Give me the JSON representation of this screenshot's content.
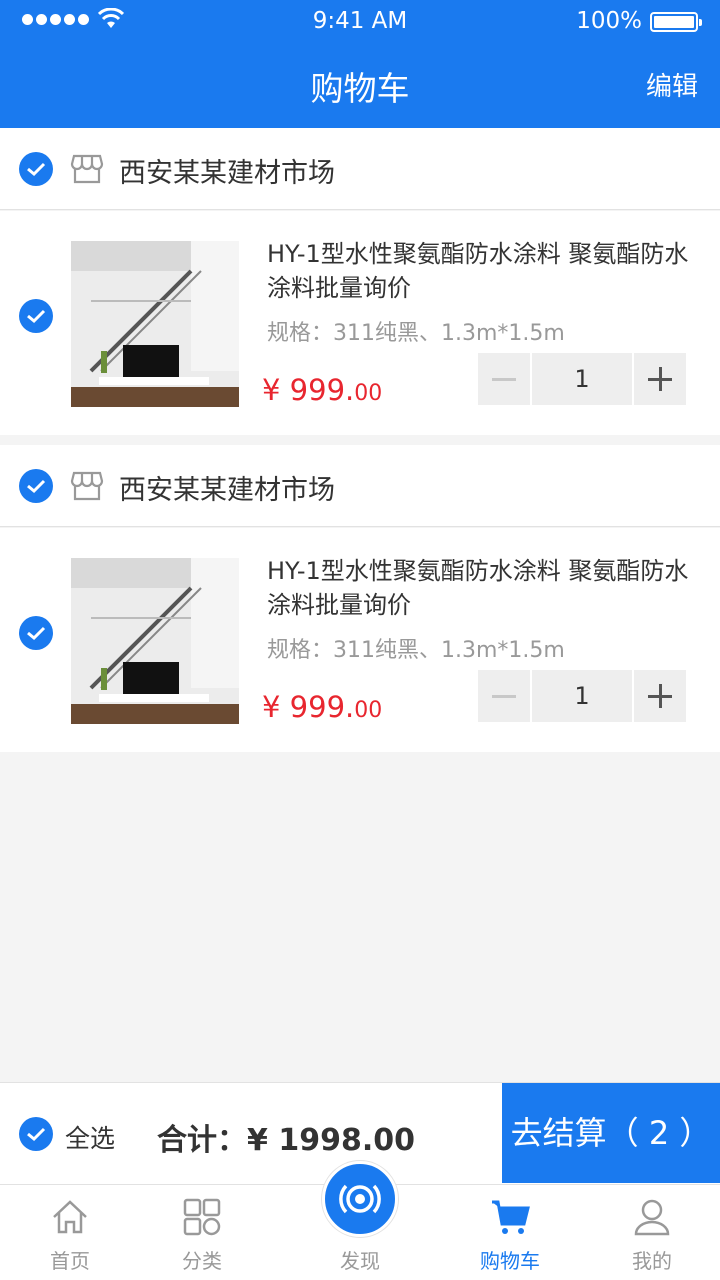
{
  "status_bar": {
    "time": "9:41 AM",
    "battery": "100%"
  },
  "header": {
    "title": "购物车",
    "edit_label": "编辑"
  },
  "stores": [
    {
      "name": "西安某某建材市场",
      "item": {
        "title": "HY-1型水性聚氨酯防水涂料 聚氨酯防水涂料批量询价",
        "spec": "规格：311纯黑、1.3m*1.5m",
        "price_main": "¥ 999.",
        "price_cents": "00",
        "quantity": "1"
      }
    },
    {
      "name": "西安某某建材市场",
      "item": {
        "title": "HY-1型水性聚氨酯防水涂料 聚氨酯防水涂料批量询价",
        "spec": "规格：311纯黑、1.3m*1.5m",
        "price_main": "¥ 999.",
        "price_cents": "00",
        "quantity": "1"
      }
    }
  ],
  "checkout": {
    "select_all_label": "全选",
    "total_text": "合计：¥ 1998.00",
    "pay_label": "去结算（ 2 ）"
  },
  "tabbar": {
    "tabs": [
      {
        "label": "首页",
        "icon": "home-icon"
      },
      {
        "label": "分类",
        "icon": "category-icon"
      },
      {
        "label": "发现",
        "icon": "discover-icon"
      },
      {
        "label": "购物车",
        "icon": "cart-icon"
      },
      {
        "label": "我的",
        "icon": "user-icon"
      }
    ]
  },
  "colors": {
    "accent": "#1a7aef",
    "price": "#e8262f",
    "background": "#f4f4f4"
  }
}
